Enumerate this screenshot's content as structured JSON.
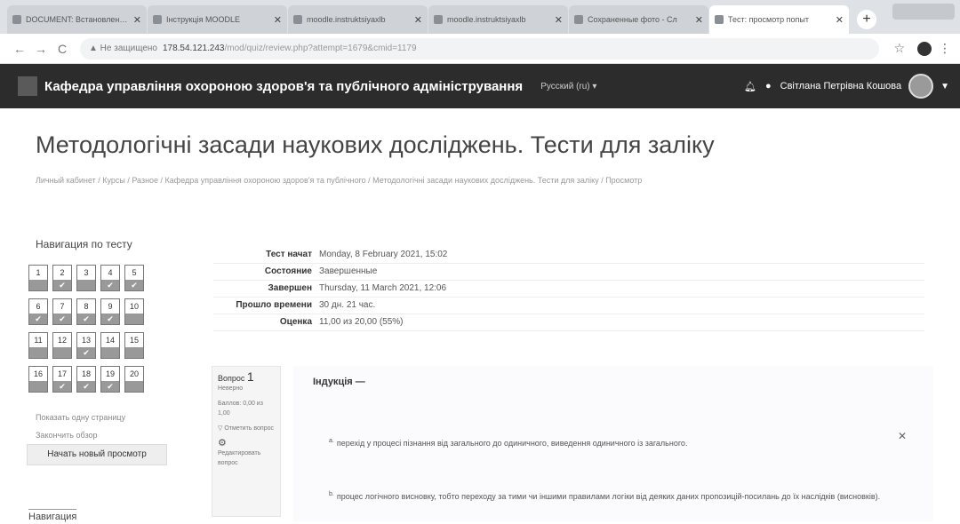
{
  "browser": {
    "tabs": [
      {
        "title": "DOCUMENT: Встановлення. Ви",
        "active": false
      },
      {
        "title": "Інструкція MOODLE",
        "active": false
      },
      {
        "title": "moodle.instruktsiyaxlb",
        "active": false
      },
      {
        "title": "moodle.instruktsiyaxlb",
        "active": false
      },
      {
        "title": "Сохраненные фото - Сл",
        "active": false
      },
      {
        "title": "Тест: просмотр попыт",
        "active": true
      }
    ],
    "new_tab": "+",
    "url": {
      "warning": "▲ Не защищено",
      "host": "178.54.121.243",
      "path": "/mod/quiz/review.php?attempt=1679&cmid=1179"
    }
  },
  "navbar": {
    "site_title": "Кафедра управління охороною здоров'я та публічного адміністрування",
    "language": "Русский (ru) ▾",
    "user_name": "Світлана Петрівна Кошова"
  },
  "page": {
    "title": "Методологічні засади наукових досліджень. Тести для заліку",
    "breadcrumb": "Личный кабинет / Курсы / Разное / Кафедра управління охороною здоров'я та публічного / Методологічні засади наукових досліджень. Тести для заліку / Просмотр"
  },
  "quiz_nav": {
    "title": "Навигация по тесту",
    "rows": [
      [
        {
          "n": "1",
          "mark": ""
        },
        {
          "n": "2",
          "mark": "✔"
        },
        {
          "n": "3",
          "mark": ""
        },
        {
          "n": "4",
          "mark": "✔"
        },
        {
          "n": "5",
          "mark": "✔"
        }
      ],
      [
        {
          "n": "6",
          "mark": "✔"
        },
        {
          "n": "7",
          "mark": "✔"
        },
        {
          "n": "8",
          "mark": "✔"
        },
        {
          "n": "9",
          "mark": "✔"
        },
        {
          "n": "10",
          "mark": ""
        }
      ],
      [
        {
          "n": "11",
          "mark": ""
        },
        {
          "n": "12",
          "mark": ""
        },
        {
          "n": "13",
          "mark": "✔"
        },
        {
          "n": "14",
          "mark": ""
        },
        {
          "n": "15",
          "mark": ""
        }
      ],
      [
        {
          "n": "16",
          "mark": ""
        },
        {
          "n": "17",
          "mark": "✔"
        },
        {
          "n": "18",
          "mark": "✔"
        },
        {
          "n": "19",
          "mark": "✔"
        },
        {
          "n": "20",
          "mark": ""
        }
      ]
    ],
    "show_one_page": "Показать одну страницу",
    "finish_review": "Закончить обзор",
    "new_review_button": "Начать новый просмотр",
    "footer_title": "Навигация"
  },
  "summary": [
    {
      "label": "Тест начат",
      "value": "Monday, 8 February 2021, 15:02"
    },
    {
      "label": "Состояние",
      "value": "Завершенные"
    },
    {
      "label": "Завершен",
      "value": "Thursday, 11 March 2021, 12:06"
    },
    {
      "label": "Прошло времени",
      "value": "30 дн. 21 час."
    },
    {
      "label": "Оценка",
      "value": "11,00 из 20,00 (55%)"
    }
  ],
  "question": {
    "label": "Вопрос",
    "number": "1",
    "status": "Неверно",
    "points": "Баллов: 0,00 из 1,00",
    "flag": "Отметить вопрос",
    "edit": "Редактировать вопрос",
    "text": "Індукція —",
    "answers": [
      {
        "letter": "a.",
        "text": "перехід у процесі пізнання від загального до одиничного, виведення одиничного із загального."
      },
      {
        "letter": "b.",
        "text": "процес логічного висновку, тобто переходу за тими чи іншими правилами логіки від деяких даних пропозицій-посилань до їх наслідків (висновків)."
      }
    ],
    "wrong_mark": "✕"
  }
}
